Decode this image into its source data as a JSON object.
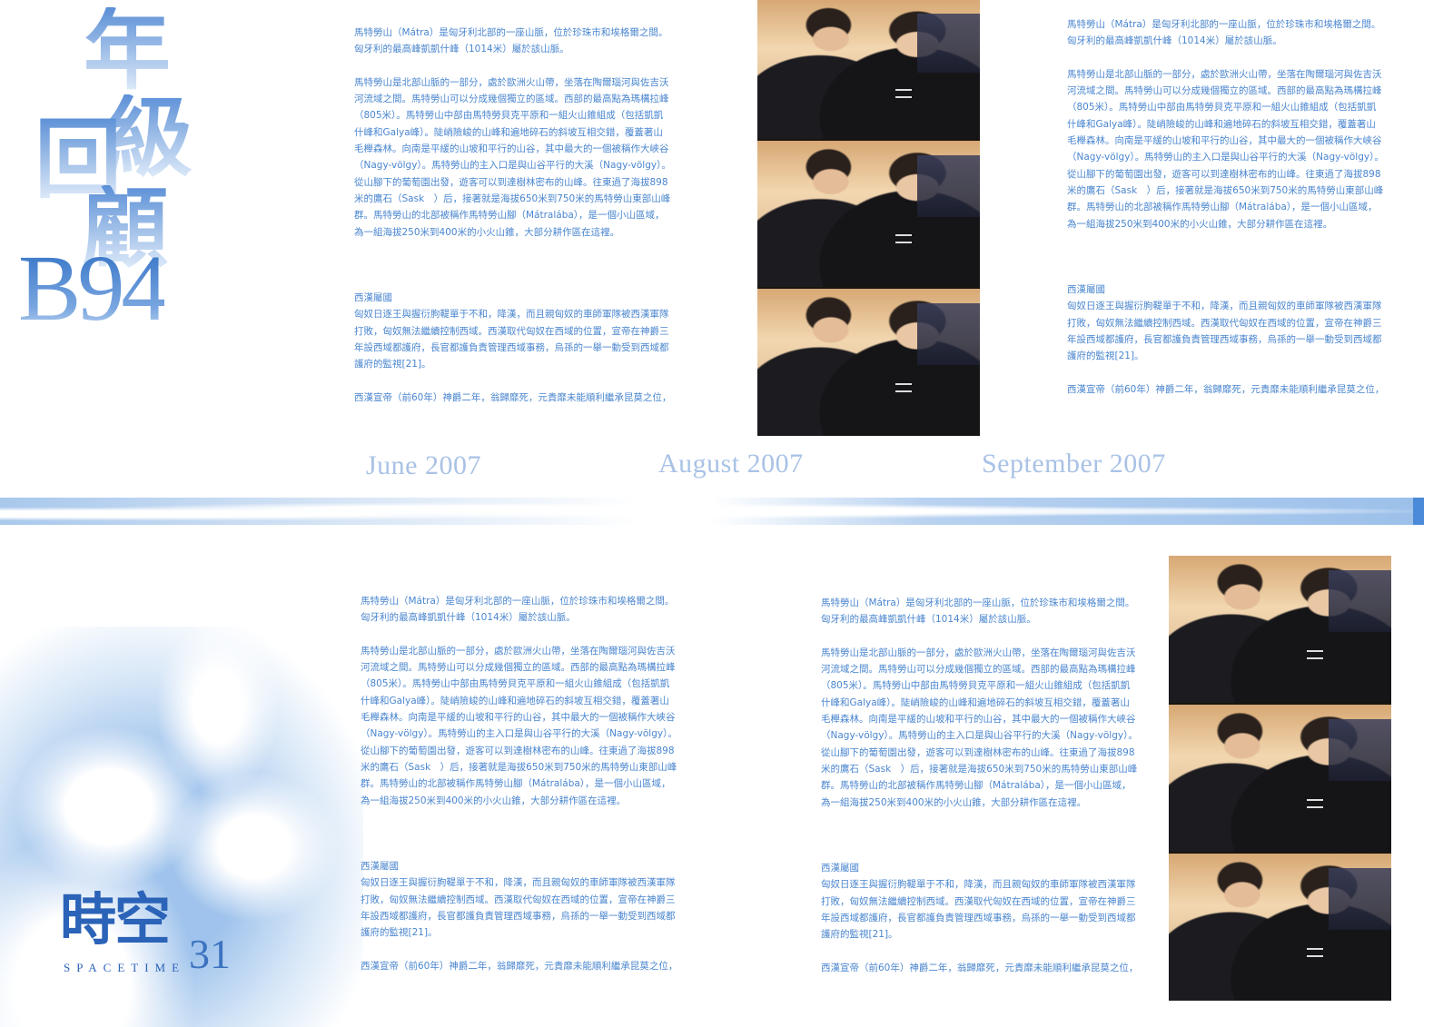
{
  "title": {
    "line1": "年",
    "line2": "級",
    "line3": "回",
    "line4": "顧",
    "code": "B94"
  },
  "article": {
    "p1": "馬特勞山（Mátra）是匈牙利北部的一座山脈，位於珍珠市和埃格爾之間。匈牙利的最高峰凱凱什峰（1014米）屬於該山脈。",
    "p2": "馬特勞山是北部山脈的一部分，處於歐洲火山帶，坐落在陶爾瑙河與佐吉沃河流域之間。馬特勞山可以分成幾個獨立的區域。西部的最高點為瑪構拉峰（805米）。馬特勞山中部由馬特勞貝克平原和一組火山錐組成（包括凱凱什峰和Galya峰）。陡峭險峻的山峰和遍地碎石的斜坡互相交錯，覆蓋著山毛櫸森林。向南是平緩的山坡和平行的山谷，其中最大的一個被稱作大峽谷（Nagy-völgy）。馬特勞山的主入口是與山谷平行的大溪（Nagy-völgy）。從山腳下的葡萄園出發，遊客可以到達樹林密布的山峰。往東過了海拔898米的鷹石（Sask　）后，接著就是海拔650米到750米的馬特勞山東部山峰群。馬特勞山的北部被稱作馬特勞山腳（Mátralába），是一個小山區域，為一組海拔250米到400米的小火山錐，大部分耕作區在這裡。",
    "heading": "西漢屬國",
    "p3": "匈奴日逐王與握衍朐鞮單于不和，降漢，而且親匈奴的車師軍隊被西漢軍隊打敗，匈奴無法繼續控制西域。西漢取代匈奴在西域的位置，宣帝在神爵三年設西域都護府，長官都護負責管理西域事務，烏孫的一舉一動受到西域都護府的監視[21]。",
    "p4": "西漢宣帝（前60年）神爵二年，翁歸靡死，元貴靡未能順利繼承昆莫之位，"
  },
  "dates": {
    "d1": "June 2007",
    "d2": "August 2007",
    "d3": "September 2007"
  },
  "brand": {
    "name": "時空",
    "number": "31",
    "sub": "SPACETIME"
  }
}
